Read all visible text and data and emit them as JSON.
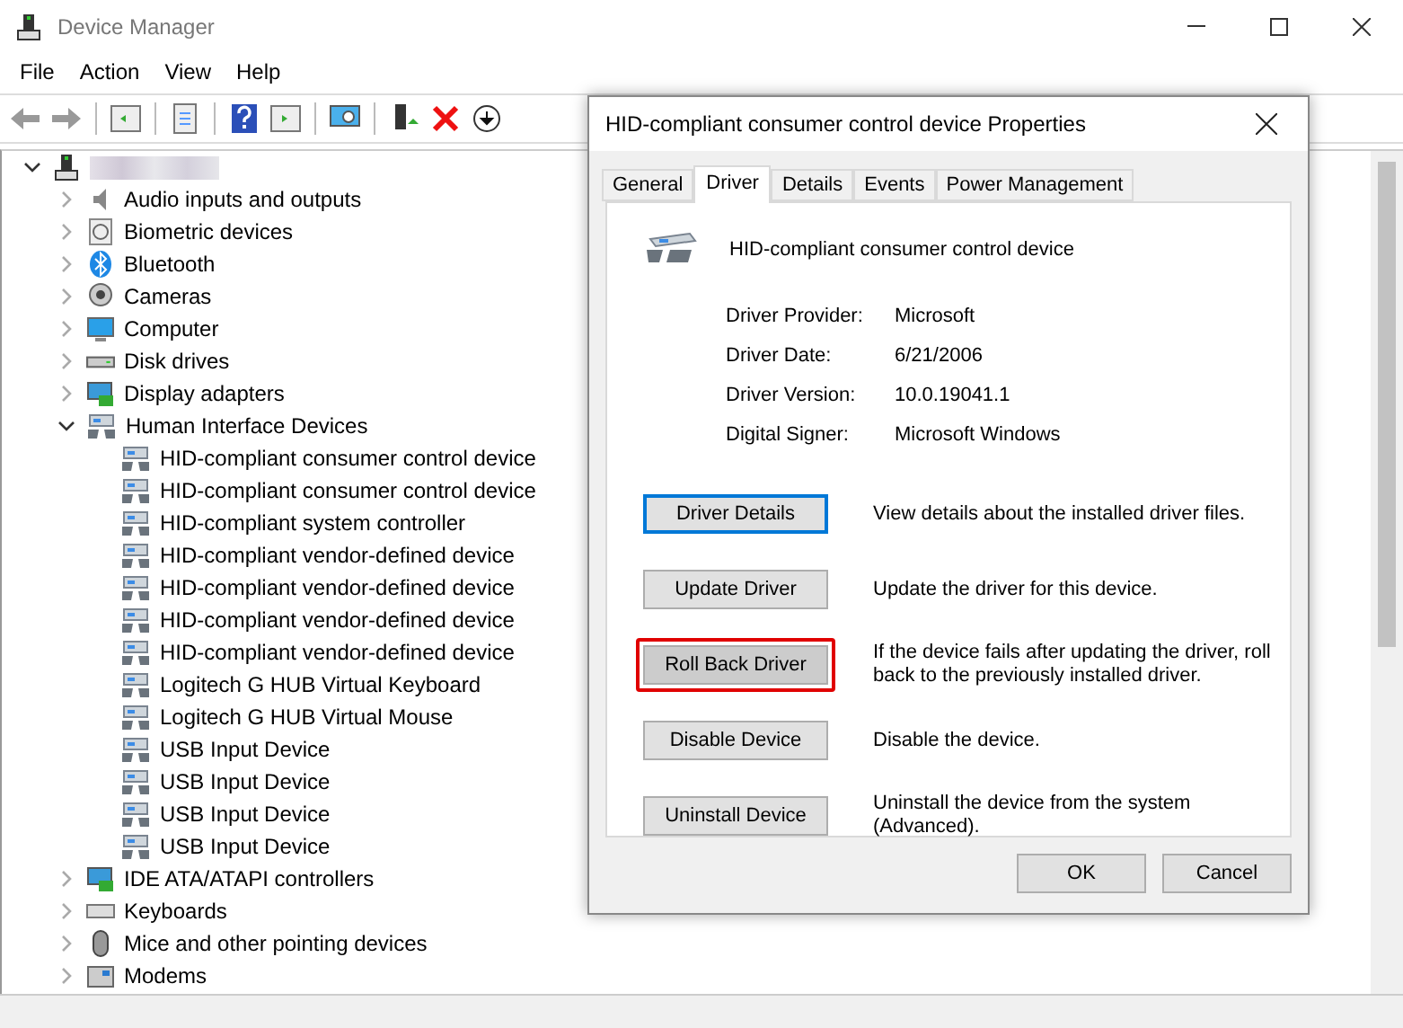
{
  "window": {
    "title": "Device Manager"
  },
  "menu": [
    "File",
    "Action",
    "View",
    "Help"
  ],
  "tree": {
    "expanded": true,
    "children": [
      {
        "label": "Audio inputs and outputs",
        "kind": "audio",
        "expanded": false
      },
      {
        "label": "Biometric devices",
        "kind": "biometric",
        "expanded": false
      },
      {
        "label": "Bluetooth",
        "kind": "bluetooth",
        "expanded": false
      },
      {
        "label": "Cameras",
        "kind": "camera",
        "expanded": false
      },
      {
        "label": "Computer",
        "kind": "monitor",
        "expanded": false
      },
      {
        "label": "Disk drives",
        "kind": "disk",
        "expanded": false
      },
      {
        "label": "Display adapters",
        "kind": "adapter",
        "expanded": false
      },
      {
        "label": "Human Interface Devices",
        "kind": "hid",
        "expanded": true,
        "children": [
          {
            "label": "HID-compliant consumer control device",
            "kind": "hid"
          },
          {
            "label": "HID-compliant consumer control device",
            "kind": "hid"
          },
          {
            "label": "HID-compliant system controller",
            "kind": "hid"
          },
          {
            "label": "HID-compliant vendor-defined device",
            "kind": "hid"
          },
          {
            "label": "HID-compliant vendor-defined device",
            "kind": "hid"
          },
          {
            "label": "HID-compliant vendor-defined device",
            "kind": "hid"
          },
          {
            "label": "HID-compliant vendor-defined device",
            "kind": "hid"
          },
          {
            "label": "Logitech G HUB Virtual Keyboard",
            "kind": "hid"
          },
          {
            "label": "Logitech G HUB Virtual Mouse",
            "kind": "hid"
          },
          {
            "label": "USB Input Device",
            "kind": "hid"
          },
          {
            "label": "USB Input Device",
            "kind": "hid"
          },
          {
            "label": "USB Input Device",
            "kind": "hid"
          },
          {
            "label": "USB Input Device",
            "kind": "hid"
          }
        ]
      },
      {
        "label": "IDE ATA/ATAPI controllers",
        "kind": "adapter",
        "expanded": false
      },
      {
        "label": "Keyboards",
        "kind": "keyboard",
        "expanded": false
      },
      {
        "label": "Mice and other pointing devices",
        "kind": "mouse",
        "expanded": false
      },
      {
        "label": "Modems",
        "kind": "modem",
        "expanded": false
      }
    ]
  },
  "dialog": {
    "title": "HID-compliant consumer control device Properties",
    "tabs": [
      {
        "label": "General",
        "selected": false
      },
      {
        "label": "Driver",
        "selected": true
      },
      {
        "label": "Details",
        "selected": false
      },
      {
        "label": "Events",
        "selected": false
      },
      {
        "label": "Power Management",
        "selected": false
      }
    ],
    "device_name": "HID-compliant consumer control device",
    "properties": [
      {
        "label": "Driver Provider:",
        "value": "Microsoft"
      },
      {
        "label": "Driver Date:",
        "value": "6/21/2006"
      },
      {
        "label": "Driver Version:",
        "value": "10.0.19041.1"
      },
      {
        "label": "Digital Signer:",
        "value": "Microsoft Windows"
      }
    ],
    "actions": [
      {
        "button": "Driver Details",
        "description": "View details about the installed driver files.",
        "focused": true,
        "highlighted": false
      },
      {
        "button": "Update Driver",
        "description": "Update the driver for this device.",
        "focused": false,
        "highlighted": false
      },
      {
        "button": "Roll Back Driver",
        "description": "If the device fails after updating the driver, roll back to the previously installed driver.",
        "focused": false,
        "highlighted": true
      },
      {
        "button": "Disable Device",
        "description": "Disable the device.",
        "focused": false,
        "highlighted": false
      },
      {
        "button": "Uninstall Device",
        "description": "Uninstall the device from the system (Advanced).",
        "focused": false,
        "highlighted": false
      }
    ],
    "buttons": [
      "OK",
      "Cancel"
    ]
  }
}
